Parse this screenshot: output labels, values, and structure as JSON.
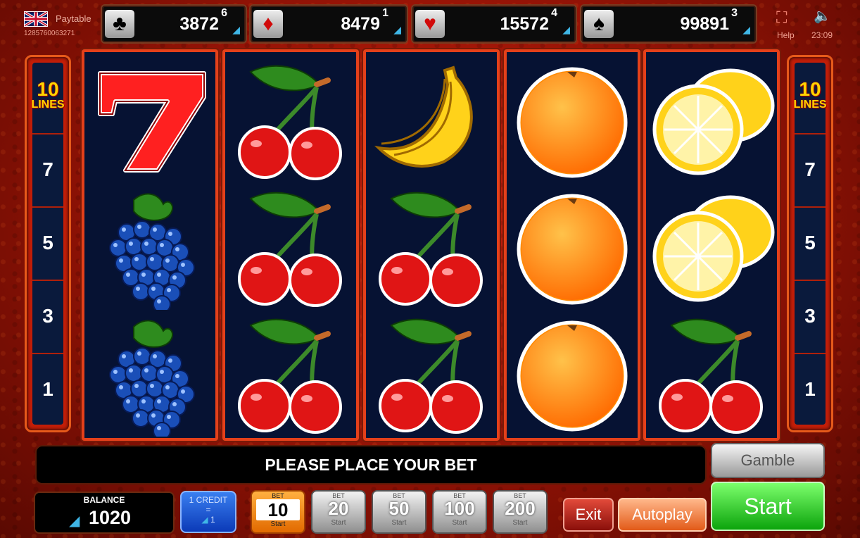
{
  "header": {
    "paytable_label": "Paytable",
    "game_id": "1285760063271",
    "help_label": "Help",
    "clock": "23:09"
  },
  "jackpots": [
    {
      "suit": "clubs",
      "symbol": "♣",
      "amount": "3872",
      "sup": "6",
      "color": "#111111"
    },
    {
      "suit": "diamonds",
      "symbol": "♦",
      "amount": "8479",
      "sup": "1",
      "color": "#d10a0a"
    },
    {
      "suit": "hearts",
      "symbol": "♥",
      "amount": "15572",
      "sup": "4",
      "color": "#d10a0a"
    },
    {
      "suit": "spades",
      "symbol": "♠",
      "amount": "99891",
      "sup": "3",
      "color": "#111111"
    }
  ],
  "lines_panel": {
    "lines_count": "10",
    "lines_label": "LINES",
    "numbers": [
      "7",
      "5",
      "3",
      "1"
    ]
  },
  "reels": [
    [
      "seven",
      "grapes",
      "grapes"
    ],
    [
      "cherry",
      "cherry",
      "cherry"
    ],
    [
      "banana",
      "cherry",
      "cherry"
    ],
    [
      "orange",
      "orange",
      "orange"
    ],
    [
      "lemon",
      "lemon",
      "cherry"
    ]
  ],
  "message": "PLEASE PLACE YOUR BET",
  "gamble_label": "Gamble",
  "balance": {
    "label": "BALANCE",
    "value": "1020"
  },
  "credit": {
    "line1": "1 CREDIT",
    "line2": "=",
    "line3": "1"
  },
  "bets": [
    {
      "label": "BET",
      "value": "10",
      "sub": "Start",
      "active": true
    },
    {
      "label": "BET",
      "value": "20",
      "sub": "Start",
      "active": false
    },
    {
      "label": "BET",
      "value": "50",
      "sub": "Start",
      "active": false
    },
    {
      "label": "BET",
      "value": "100",
      "sub": "Start",
      "active": false
    },
    {
      "label": "BET",
      "value": "200",
      "sub": "Start",
      "active": false
    }
  ],
  "exit_label": "Exit",
  "autoplay_label": "Autoplay",
  "start_label": "Start"
}
